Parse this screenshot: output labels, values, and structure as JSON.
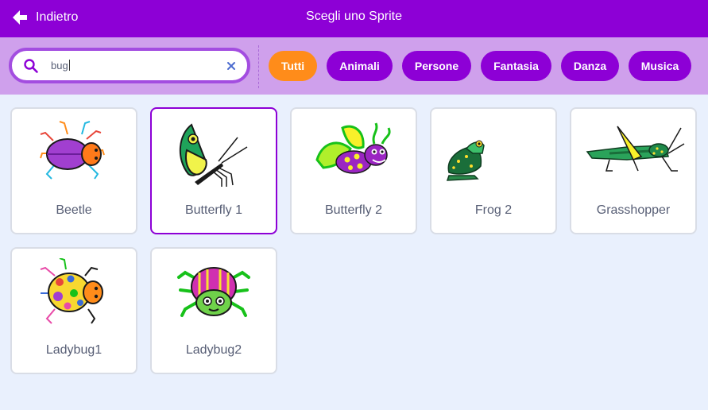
{
  "header": {
    "back_label": "Indietro",
    "title": "Scegli uno Sprite"
  },
  "search": {
    "value": "bug"
  },
  "tags": [
    {
      "label": "Tutti",
      "active": true
    },
    {
      "label": "Animali"
    },
    {
      "label": "Persone"
    },
    {
      "label": "Fantasia"
    },
    {
      "label": "Danza"
    },
    {
      "label": "Musica"
    }
  ],
  "sprites": [
    {
      "name": "Beetle",
      "icon": "beetle-icon"
    },
    {
      "name": "Butterfly 1",
      "icon": "butterfly-icon",
      "selected": true
    },
    {
      "name": "Butterfly 2",
      "icon": "butterfly-icon"
    },
    {
      "name": "Frog 2",
      "icon": "frog-icon"
    },
    {
      "name": "Grasshopper",
      "icon": "grasshopper-icon"
    },
    {
      "name": "Ladybug1",
      "icon": "ladybug-icon"
    },
    {
      "name": "Ladybug2",
      "icon": "ladybug-icon"
    }
  ],
  "colors": {
    "header": "#8d00d6",
    "filter_bar": "#cfa0ec",
    "active_tag": "#ff8c1a",
    "background": "#e9f0fd"
  }
}
